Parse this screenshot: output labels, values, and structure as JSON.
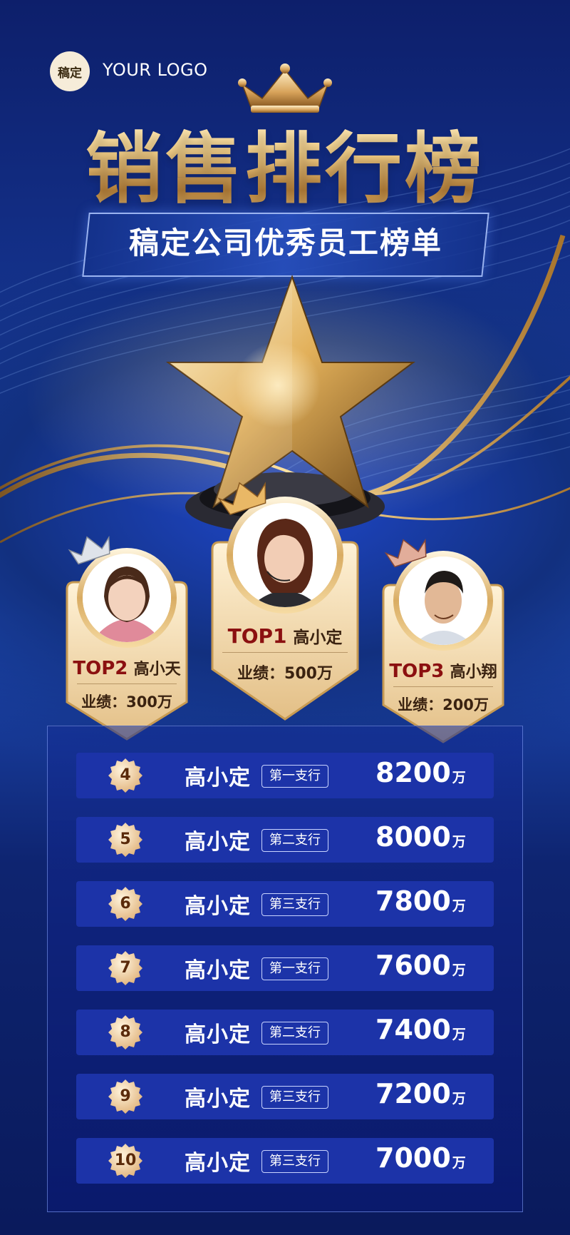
{
  "logo": {
    "badge": "稿定",
    "text": "YOUR LOGO"
  },
  "title": "销售排行榜",
  "subtitle": "稿定公司优秀员工榜单",
  "podium": [
    {
      "rank_label": "TOP1",
      "name": "高小定",
      "perf_label": "业绩：",
      "perf_value": "500万",
      "crown": "gold-crown-icon"
    },
    {
      "rank_label": "TOP2",
      "name": "高小天",
      "perf_label": "业绩：",
      "perf_value": "300万",
      "crown": "silver-crown-icon"
    },
    {
      "rank_label": "TOP3",
      "name": "高小翔",
      "perf_label": "业绩：",
      "perf_value": "200万",
      "crown": "bronze-crown-icon"
    }
  ],
  "list": [
    {
      "rank": "4",
      "name": "高小定",
      "branch": "第一支行",
      "amount": "8200",
      "unit": "万"
    },
    {
      "rank": "5",
      "name": "高小定",
      "branch": "第二支行",
      "amount": "8000",
      "unit": "万"
    },
    {
      "rank": "6",
      "name": "高小定",
      "branch": "第三支行",
      "amount": "7800",
      "unit": "万"
    },
    {
      "rank": "7",
      "name": "高小定",
      "branch": "第一支行",
      "amount": "7600",
      "unit": "万"
    },
    {
      "rank": "8",
      "name": "高小定",
      "branch": "第二支行",
      "amount": "7400",
      "unit": "万"
    },
    {
      "rank": "9",
      "name": "高小定",
      "branch": "第三支行",
      "amount": "7200",
      "unit": "万"
    },
    {
      "rank": "10",
      "name": "高小定",
      "branch": "第三支行",
      "amount": "7000",
      "unit": "万"
    }
  ],
  "colors": {
    "gold": "#e8c07a",
    "navy": "#0a1a5c",
    "row": "#1c33a8",
    "rank_red": "#8b1010"
  }
}
